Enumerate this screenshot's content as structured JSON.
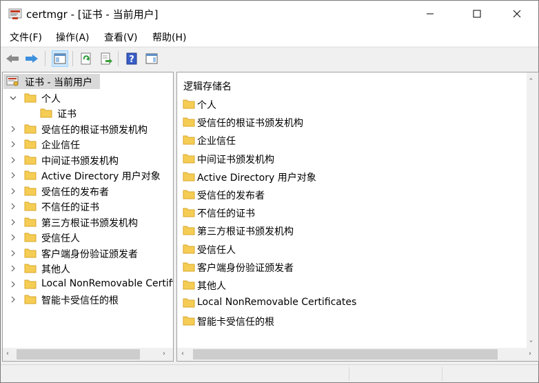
{
  "window": {
    "title": "certmgr - [证书 - 当前用户]"
  },
  "menu": [
    {
      "label": "文件(F)"
    },
    {
      "label": "操作(A)"
    },
    {
      "label": "查看(V)"
    },
    {
      "label": "帮助(H)"
    }
  ],
  "toolbar": {
    "icons": [
      "back-arrow-icon",
      "forward-arrow-icon",
      "show-hide-console-tree-icon",
      "refresh-icon",
      "export-list-icon",
      "help-icon",
      "show-hide-action-pane-icon"
    ]
  },
  "tree": {
    "root_label": "证书 - 当前用户",
    "items": [
      {
        "label": "个人",
        "expanded": true,
        "children": [
          {
            "label": "证书"
          }
        ]
      },
      {
        "label": "受信任的根证书颁发机构"
      },
      {
        "label": "企业信任"
      },
      {
        "label": "中间证书颁发机构"
      },
      {
        "label": "Active Directory 用户对象"
      },
      {
        "label": "受信任的发布者"
      },
      {
        "label": "不信任的证书"
      },
      {
        "label": "第三方根证书颁发机构"
      },
      {
        "label": "受信任人"
      },
      {
        "label": "客户端身份验证颁发者"
      },
      {
        "label": "其他人"
      },
      {
        "label": "Local NonRemovable Certifi"
      },
      {
        "label": "智能卡受信任的根"
      }
    ]
  },
  "list": {
    "header": "逻辑存储名",
    "items": [
      "个人",
      "受信任的根证书颁发机构",
      "企业信任",
      "中间证书颁发机构",
      "Active Directory 用户对象",
      "受信任的发布者",
      "不信任的证书",
      "第三方根证书颁发机构",
      "受信任人",
      "客户端身份验证颁发者",
      "其他人",
      "Local NonRemovable Certificates",
      "智能卡受信任的根"
    ]
  },
  "colors": {
    "folder": "#f5cd55",
    "folder_edge": "#d8a626",
    "selection": "#d9d9d9"
  }
}
